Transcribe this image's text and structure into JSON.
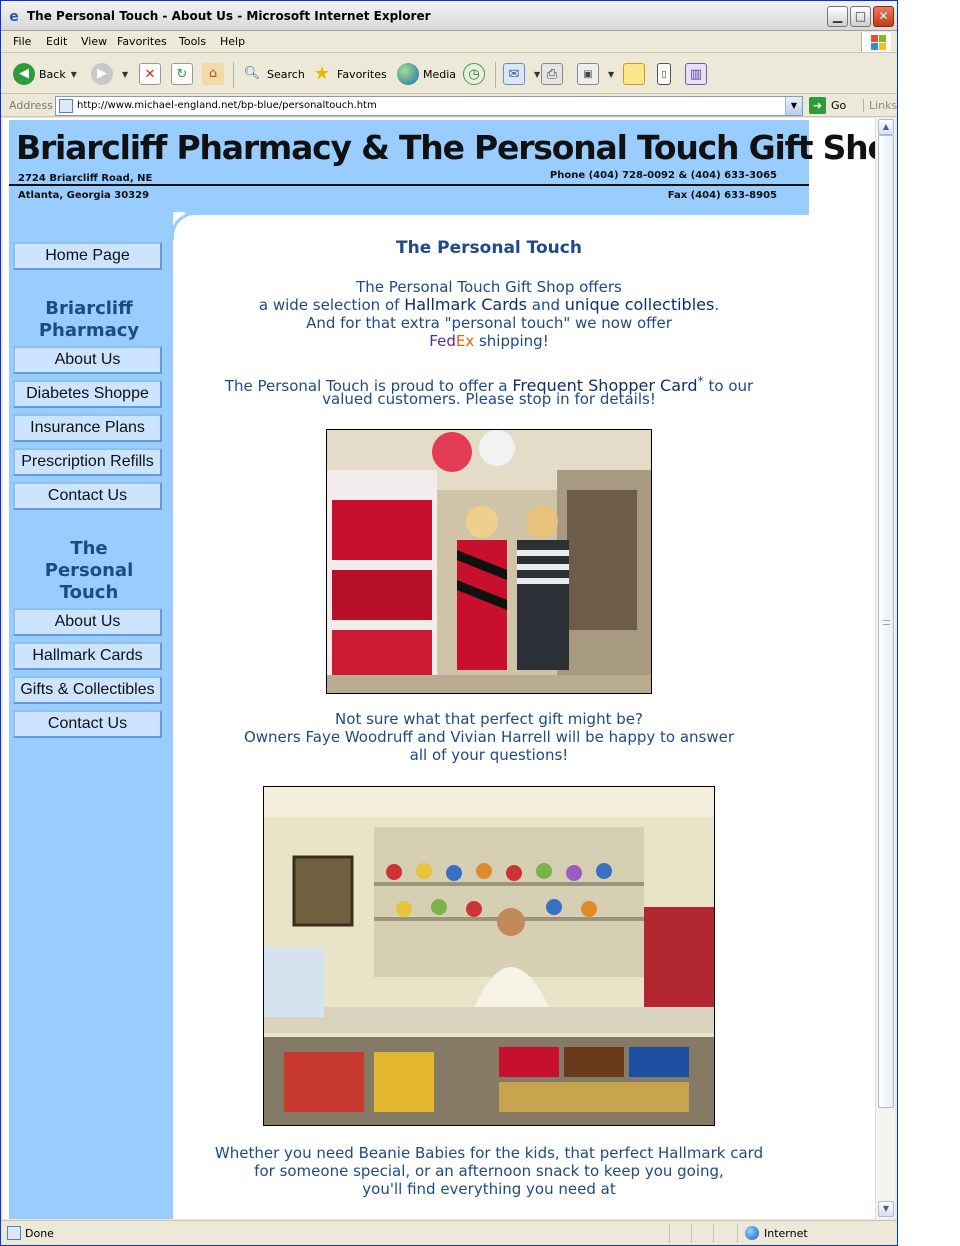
{
  "window": {
    "title": "The Personal Touch - About Us - Microsoft Internet Explorer"
  },
  "menu": [
    "File",
    "Edit",
    "View",
    "Favorites",
    "Tools",
    "Help"
  ],
  "toolbar": {
    "back": "Back",
    "search": "Search",
    "favorites": "Favorites",
    "media": "Media"
  },
  "address": {
    "label": "Address",
    "url": "http://www.michael-england.net/bp-blue/personaltouch.htm",
    "go": "Go",
    "links": "Links"
  },
  "header": {
    "title": "Briarcliff Pharmacy & The Personal Touch Gift Shop",
    "street": "2724 Briarcliff Road, NE",
    "city": "Atlanta, Georgia 30329",
    "phone": "Phone (404) 728-0092 & (404) 633-3065",
    "fax": "Fax (404) 633-8905"
  },
  "nav": {
    "home": "Home Page",
    "pharmacy_heading": [
      "Briarcliff",
      "Pharmacy"
    ],
    "pharmacy_items": [
      "About Us",
      "Diabetes Shoppe",
      "Insurance Plans",
      "Prescription Refills",
      "Contact Us"
    ],
    "touch_heading": [
      "The",
      "Personal",
      "Touch"
    ],
    "touch_items": [
      "About Us",
      "Hallmark Cards",
      "Gifts & Collectibles",
      "Contact Us"
    ]
  },
  "content": {
    "heading": "The Personal Touch",
    "intro_line1": "The Personal Touch Gift Shop offers",
    "intro_line2_pre": "a wide selection of ",
    "intro_line2_hallmark": "Hallmark Cards",
    "intro_line2_mid": " and ",
    "intro_line2_unique": "unique collectibles",
    "intro_line2_end": ".",
    "intro_line3": "And for that extra \"personal touch\" we now offer",
    "fed": "Fed",
    "ex": "Ex",
    "shipping": " shipping!",
    "shopper_pre": "The Personal Touch is proud to offer a ",
    "shopper_card": "Frequent Shopper Card",
    "shopper_star": "*",
    "shopper_post": " to our",
    "shopper_line2": "valued customers.  Please stop in for details!",
    "owners_line1": "Not sure what that perfect gift might be?",
    "owners_line2": "Owners Faye Woodruff and Vivian Harrell will be happy to answer",
    "owners_line3": "all of your questions!",
    "closing_line1": "Whether you need Beanie Babies for the kids, that perfect Hallmark card",
    "closing_line2": "for someone special, or an afternoon snack to keep you going,",
    "closing_line3": "you'll find everything you need at"
  },
  "status": {
    "text": "Done",
    "zone": "Internet"
  },
  "colors": {
    "sky": "#99ccff",
    "text_blue": "#1f4a85",
    "fedex_purple": "#5a2a91",
    "fedex_orange": "#e2660f"
  }
}
